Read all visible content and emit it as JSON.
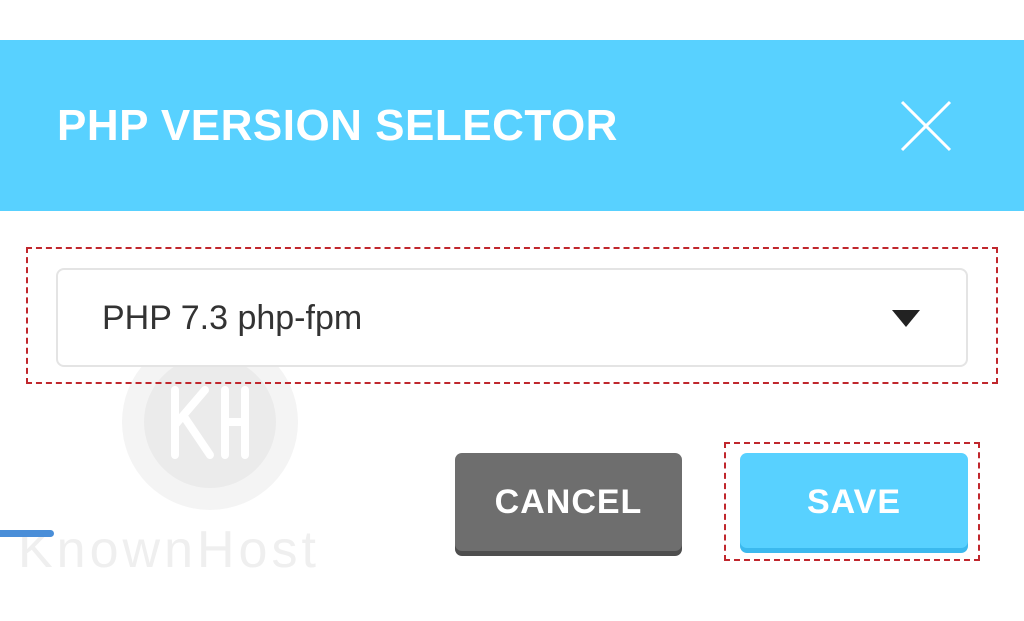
{
  "modal": {
    "title": "PHP VERSION SELECTOR",
    "header_color": "#58d1ff"
  },
  "version_select": {
    "selected": "PHP 7.3 php-fpm"
  },
  "actions": {
    "cancel_label": "CANCEL",
    "save_label": "SAVE"
  },
  "watermark": {
    "brand": "KnownHost"
  },
  "icons": {
    "close": "close-icon",
    "dropdown": "caret-down-icon",
    "watermark_logo": "kh-logo-icon"
  },
  "colors": {
    "accent": "#58d1ff",
    "cancel": "#6e6e6e",
    "highlight": "#c0272d"
  }
}
